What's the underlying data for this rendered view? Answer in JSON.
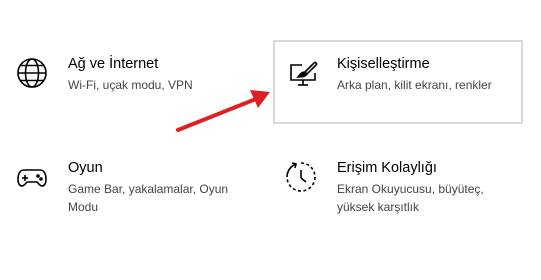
{
  "tiles": [
    {
      "title": "Ağ ve İnternet",
      "description": "Wi-Fi, uçak modu, VPN",
      "icon": "globe-icon"
    },
    {
      "title": "Kişiselleştirme",
      "description": "Arka plan, kilit ekranı, renkler",
      "icon": "paintbrush-monitor-icon"
    },
    {
      "title": "Oyun",
      "description": "Game Bar, yakalamalar, Oyun Modu",
      "icon": "gamepad-icon"
    },
    {
      "title": "Erişim Kolaylığı",
      "description": "Ekran Okuyucusu, büyüteç, yüksek karşıtlık",
      "icon": "ease-of-access-icon"
    }
  ],
  "colors": {
    "annotation_arrow": "#e02020",
    "selected_border": "#d9d9d9",
    "description_text": "#444444"
  }
}
